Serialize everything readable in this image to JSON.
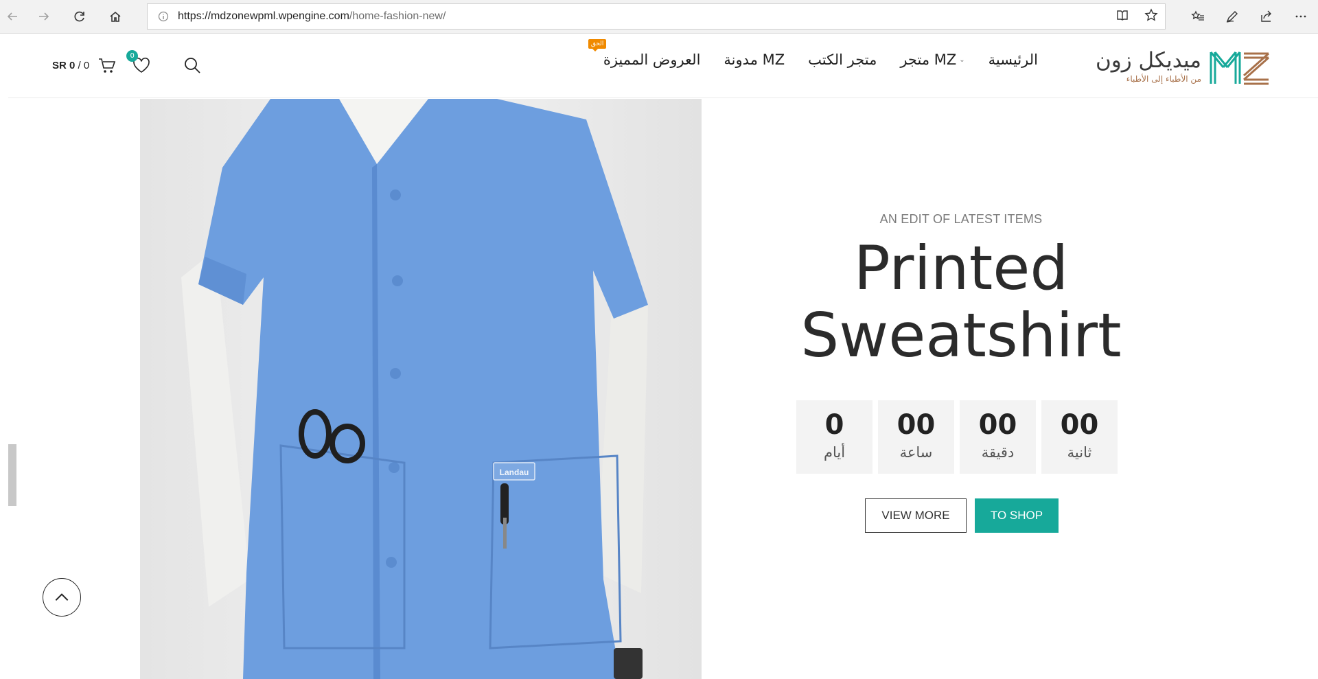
{
  "browser": {
    "url_domain": "https://mdzonewpml.wpengine.com",
    "url_path": "/home-fashion-new/"
  },
  "site": {
    "logo": {
      "main": "ميديكل زون",
      "sub": "من الأطباء إلى الأطباء",
      "brand_color": "#17a99a",
      "accent_color": "#a8714a"
    },
    "menu": [
      {
        "label": "الرئيسية"
      },
      {
        "label": "متجر MZ",
        "has_dropdown": true
      },
      {
        "label": "متجر الكتب"
      },
      {
        "label": "مدونة MZ"
      },
      {
        "label": "العروض المميزة",
        "badge": "الحق"
      }
    ],
    "cart": {
      "currency": "SR",
      "amount": "0",
      "count": "0"
    },
    "wishlist_count": "0"
  },
  "hero": {
    "eyebrow": "AN EDIT OF LATEST ITEMS",
    "title_line1": "Printed",
    "title_line2": "Sweatshirt",
    "countdown": [
      {
        "value": "00",
        "label": "ثانية"
      },
      {
        "value": "00",
        "label": "دقيقة"
      },
      {
        "value": "00",
        "label": "ساعة"
      },
      {
        "value": "0",
        "label": "أيام"
      }
    ],
    "view_more_label": "VIEW MORE",
    "to_shop_label": "TO SHOP",
    "badge_text": "Landau",
    "image_colors": {
      "scrubs": "#6d9edf",
      "sleeve": "#f0f0ee",
      "backdrop": "#e9e9e9"
    }
  },
  "icons": [
    "back-icon",
    "forward-icon",
    "refresh-icon",
    "home-icon",
    "info-icon",
    "reading-view-icon",
    "favorite-star-icon",
    "favorites-list-icon",
    "pen-icon",
    "share-icon",
    "more-icon",
    "search-icon",
    "heart-icon",
    "cart-icon",
    "chevron-up-icon"
  ]
}
